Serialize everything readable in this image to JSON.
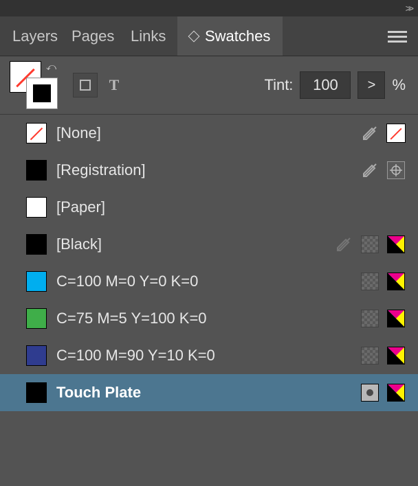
{
  "tabs": {
    "layers": "Layers",
    "pages": "Pages",
    "links": "Links",
    "swatches": "Swatches"
  },
  "toolbar": {
    "tint_label": "Tint:",
    "tint_value": "100",
    "percent": "%"
  },
  "swatches": [
    {
      "name": "[None]"
    },
    {
      "name": "[Registration]"
    },
    {
      "name": "[Paper]"
    },
    {
      "name": "[Black]"
    },
    {
      "name": "C=100 M=0 Y=0 K=0"
    },
    {
      "name": "C=75 M=5 Y=100 K=0"
    },
    {
      "name": "C=100 M=90 Y=10 K=0"
    },
    {
      "name": "Touch Plate"
    }
  ]
}
